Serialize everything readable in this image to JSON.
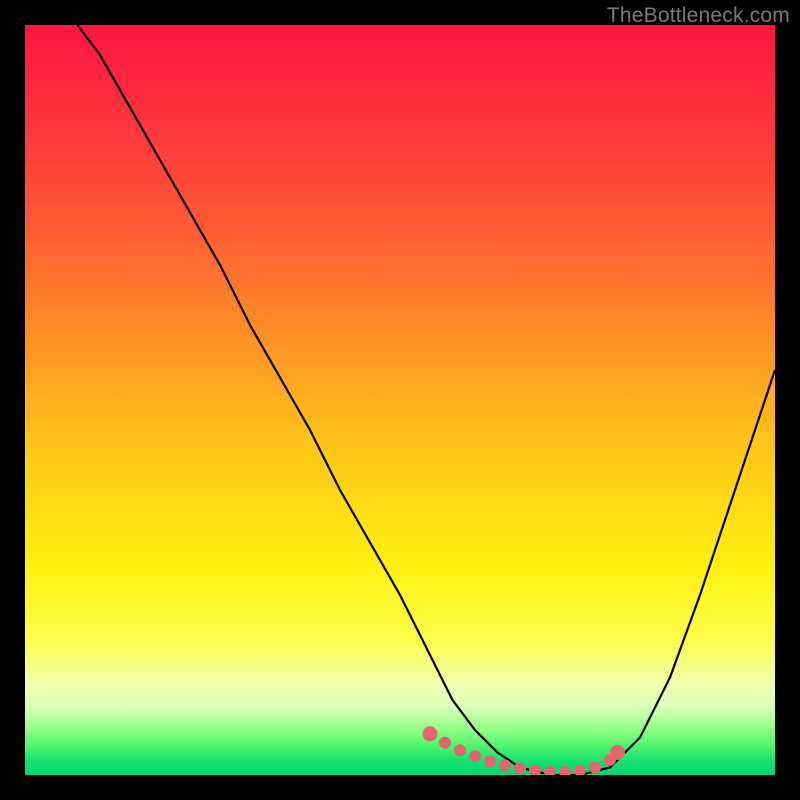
{
  "watermark": "TheBottleneck.com",
  "colors": {
    "frame": "#000000",
    "curve": "#000000",
    "marker": "#e2666f",
    "gradient_top": "#ff153f",
    "gradient_bottom": "#00d874"
  },
  "chart_data": {
    "type": "line",
    "title": "",
    "xlabel": "",
    "ylabel": "",
    "xlim": [
      0,
      100
    ],
    "ylim": [
      0,
      100
    ],
    "x": [
      7,
      10,
      14,
      18,
      22,
      26,
      30,
      34,
      38,
      42,
      46,
      50,
      54,
      57,
      60,
      63,
      66,
      70,
      74,
      78,
      82,
      86,
      90,
      94,
      98,
      100
    ],
    "values": [
      100,
      96,
      89,
      82,
      75,
      68,
      60,
      53,
      46,
      38,
      31,
      24,
      16,
      10,
      6,
      3,
      1,
      0,
      0,
      1,
      5,
      13,
      24,
      36,
      48,
      54
    ],
    "marker_region": {
      "x": [
        54,
        56,
        58,
        60,
        62,
        64,
        66,
        68,
        70,
        72,
        74,
        76,
        78,
        79
      ],
      "y": [
        5.5,
        4.3,
        3.3,
        2.5,
        1.8,
        1.3,
        0.9,
        0.6,
        0.4,
        0.4,
        0.6,
        1.0,
        2.0,
        3.0
      ]
    }
  }
}
